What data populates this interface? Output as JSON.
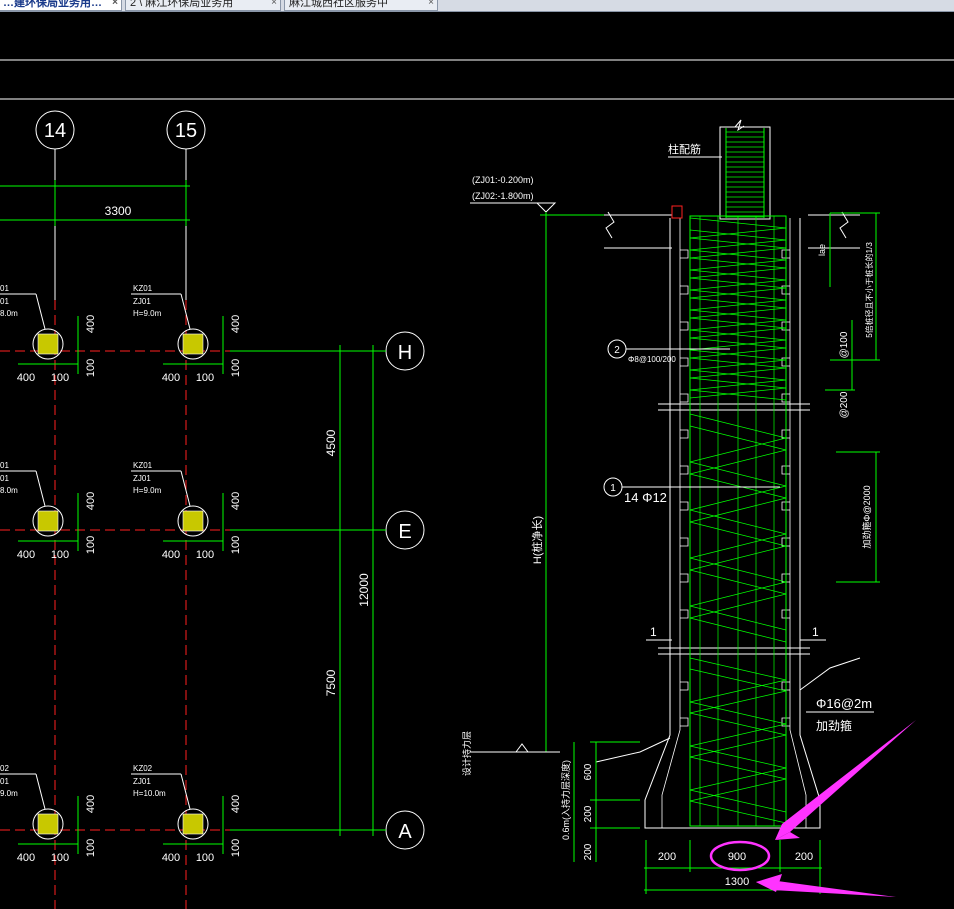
{
  "tabs": [
    {
      "label": "…建环保局业务用…"
    },
    {
      "label": "2 \\ 麻江环保局业务用"
    },
    {
      "label": "麻江城西社区服务中"
    }
  ],
  "tab_close_glyph": "×",
  "plan": {
    "axis_14": "14",
    "axis_15": "15",
    "axis_H": "H",
    "axis_E": "E",
    "axis_A": "A",
    "span_14_15": "3300",
    "dim_H_E": "4500",
    "dim_H_A": "12000",
    "dim_E_A": "7500",
    "dim_400": "400",
    "dim_100": "100",
    "piles": [
      {
        "kz": "KZ01",
        "zj": "ZJ01",
        "h": "H=9.0m",
        "kz_left": "01",
        "zj_left": "01",
        "h_left": "8.0m"
      },
      {
        "kz": "KZ01",
        "zj": "ZJ01",
        "h": "H=9.0m",
        "kz_left": "01",
        "zj_left": "01",
        "h_left": "8.0m"
      },
      {
        "kz": "KZ02",
        "zj": "ZJ01",
        "h": "H=10.0m",
        "kz_left": "02",
        "zj_left": "01",
        "h_left": "9.0m"
      }
    ]
  },
  "section": {
    "level_1": "(ZJ01:-0.200m)",
    "level_2": "(ZJ02:-1.800m)",
    "col_bars": "柱配筋",
    "lae": "lae",
    "top_dense": "5倍桩径且不小于桩长的1/3",
    "at100": "@100",
    "at200": "@200",
    "stirrup_label": "Φ8@100/200",
    "callout_2": "2",
    "callout_1": "1",
    "main_bars": "14 Φ12",
    "hoop": "加劲箍Φ@2000",
    "H_net": "H(桩净长)",
    "sec_1": "1",
    "ring_label": "Φ16@2m",
    "ring_label_2": "加劲箍",
    "bearing": "设计持力层",
    "embed": "0.6m(入持力层深度)",
    "dim_600": "600",
    "dim_200": "200",
    "bot_200": "200",
    "bot_900": "900",
    "bot_1300": "1300"
  },
  "colors": {
    "green": "#00ff00",
    "red": "#ff2020",
    "white": "#ffffff",
    "yellow": "#c8c800",
    "magenta": "#ff33ff",
    "background": "#000000"
  }
}
